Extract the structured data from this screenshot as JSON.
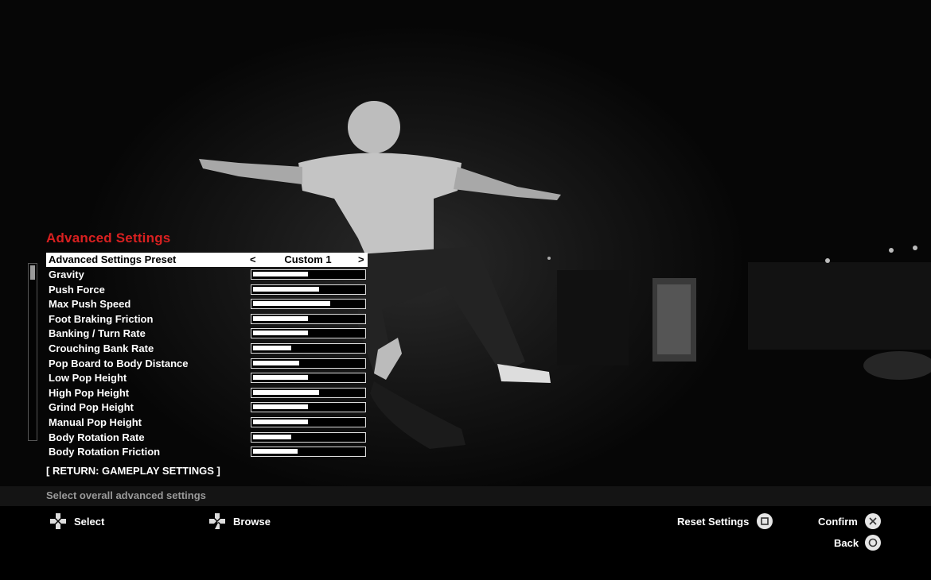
{
  "menu": {
    "title": "Advanced Settings",
    "preset": {
      "label": "Advanced Settings Preset",
      "value": "Custom 1",
      "arrow_left": "<",
      "arrow_right": ">"
    },
    "settings": [
      {
        "label": "Gravity",
        "level": 0.49
      },
      {
        "label": "Push Force",
        "level": 0.59
      },
      {
        "label": "Max Push Speed",
        "level": 0.69
      },
      {
        "label": "Foot Braking Friction",
        "level": 0.49
      },
      {
        "label": "Banking / Turn Rate",
        "level": 0.49
      },
      {
        "label": "Crouching Bank Rate",
        "level": 0.34
      },
      {
        "label": "Pop Board to Body Distance",
        "level": 0.41
      },
      {
        "label": "Low Pop Height",
        "level": 0.49
      },
      {
        "label": "High Pop Height",
        "level": 0.59
      },
      {
        "label": "Grind Pop Height",
        "level": 0.49
      },
      {
        "label": "Manual Pop Height",
        "level": 0.49
      },
      {
        "label": "Body Rotation Rate",
        "level": 0.34
      },
      {
        "label": "Body Rotation Friction",
        "level": 0.4
      }
    ],
    "return_link": "[ RETURN: GAMEPLAY SETTINGS ]",
    "scroll_position": 0.0
  },
  "hint": {
    "text": "Select overall advanced settings"
  },
  "controls": {
    "select": {
      "label": "Select",
      "icon": "dpad-icon"
    },
    "browse": {
      "label": "Browse",
      "icon": "dpad-icon"
    },
    "reset": {
      "label": "Reset Settings",
      "icon": "square-button-icon"
    },
    "confirm": {
      "label": "Confirm",
      "icon": "cross-button-icon"
    },
    "back": {
      "label": "Back",
      "icon": "circle-button-icon"
    }
  },
  "colors": {
    "title": "#d92020",
    "hint_text": "#9a9a9a",
    "button_icon": "#e6e6e6"
  }
}
